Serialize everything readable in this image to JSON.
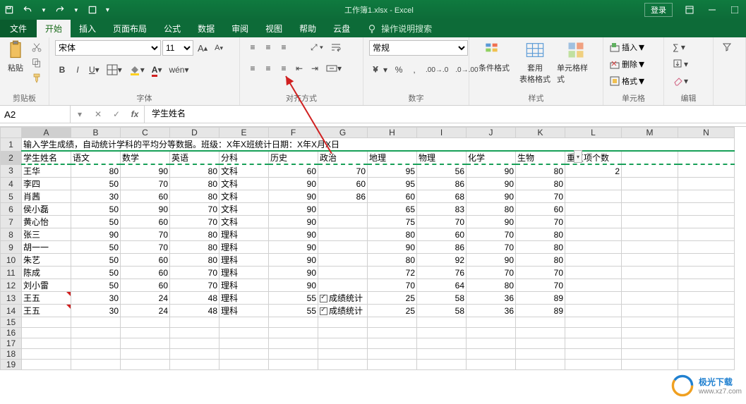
{
  "title": "工作簿1.xlsx - Excel",
  "login": "登录",
  "tabs": [
    "文件",
    "开始",
    "插入",
    "页面布局",
    "公式",
    "数据",
    "审阅",
    "视图",
    "帮助",
    "云盘"
  ],
  "tellme": "操作说明搜索",
  "ribbon": {
    "clipboard": {
      "paste": "粘贴",
      "label": "剪贴板"
    },
    "font": {
      "family": "宋体",
      "size": "11",
      "label": "字体",
      "wen": "wén"
    },
    "align": {
      "label": "对齐方式"
    },
    "number": {
      "general": "常规",
      "label": "数字"
    },
    "styles": {
      "cond": "条件格式",
      "table": "套用\n表格格式",
      "cell": "单元格样式",
      "label": "样式"
    },
    "cells": {
      "insert": "插入",
      "delete": "删除",
      "format": "格式",
      "label": "单元格"
    },
    "editing": {
      "label": "编辑"
    }
  },
  "cellref": "A2",
  "formula": "学生姓名",
  "columns": [
    "A",
    "B",
    "C",
    "D",
    "E",
    "F",
    "G",
    "H",
    "I",
    "J",
    "K",
    "L",
    "M",
    "N"
  ],
  "row1": "输入学生成绩，自动统计学科的平均分等数据。班级：X年X班统计日期：X年X月X日",
  "headers": [
    "学生姓名",
    "语文",
    "数学",
    "英语",
    "分科",
    "历史",
    "政治",
    "地理",
    "物理",
    "化学",
    "生物",
    "重复项个数"
  ],
  "rows": [
    {
      "n": 3,
      "c": [
        "王华",
        "80",
        "90",
        "80",
        "文科",
        "60",
        "70",
        "95",
        "56",
        "90",
        "80",
        "2"
      ]
    },
    {
      "n": 4,
      "c": [
        "李四",
        "50",
        "70",
        "80",
        "文科",
        "90",
        "60",
        "95",
        "86",
        "90",
        "80",
        ""
      ]
    },
    {
      "n": 5,
      "c": [
        "肖茜",
        "30",
        "60",
        "80",
        "文科",
        "90",
        "86",
        "60",
        "68",
        "90",
        "70",
        ""
      ]
    },
    {
      "n": 6,
      "c": [
        "侯小磊",
        "50",
        "90",
        "70",
        "文科",
        "90",
        "",
        "65",
        "83",
        "80",
        "60",
        ""
      ]
    },
    {
      "n": 7,
      "c": [
        "黄心怡",
        "50",
        "60",
        "70",
        "文科",
        "90",
        "",
        "75",
        "70",
        "90",
        "70",
        ""
      ]
    },
    {
      "n": 8,
      "c": [
        "张三",
        "90",
        "70",
        "80",
        "理科",
        "90",
        "",
        "80",
        "60",
        "70",
        "80",
        ""
      ]
    },
    {
      "n": 9,
      "c": [
        "胡一一",
        "50",
        "70",
        "80",
        "理科",
        "90",
        "",
        "90",
        "86",
        "70",
        "80",
        ""
      ]
    },
    {
      "n": 10,
      "c": [
        "朱艺",
        "50",
        "60",
        "80",
        "理科",
        "90",
        "",
        "80",
        "92",
        "90",
        "80",
        ""
      ]
    },
    {
      "n": 11,
      "c": [
        "陈成",
        "50",
        "60",
        "70",
        "理科",
        "90",
        "",
        "72",
        "76",
        "70",
        "70",
        ""
      ]
    },
    {
      "n": 12,
      "c": [
        "刘小雷",
        "50",
        "60",
        "70",
        "理科",
        "90",
        "",
        "70",
        "64",
        "80",
        "70",
        ""
      ]
    },
    {
      "n": 13,
      "c": [
        "王五",
        "30",
        "24",
        "48",
        "理科",
        "55",
        "☑成绩统计",
        "25",
        "58",
        "36",
        "89",
        ""
      ]
    },
    {
      "n": 14,
      "c": [
        "王五",
        "30",
        "24",
        "48",
        "理科",
        "55",
        "☑成绩统计",
        "25",
        "58",
        "36",
        "89",
        ""
      ]
    }
  ],
  "watermark": {
    "brand": "极光下载",
    "url": "www.xz7.com"
  }
}
